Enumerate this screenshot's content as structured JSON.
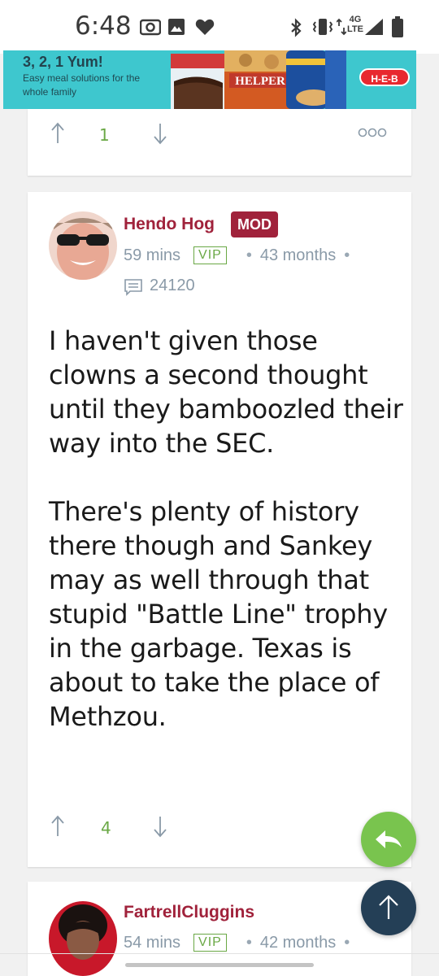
{
  "status_bar": {
    "time": "6:48",
    "network": "4G LTE",
    "icons": [
      "camera-icon",
      "gallery-icon",
      "heart-icon",
      "bluetooth-icon",
      "vibrate-icon",
      "signal-icon",
      "battery-icon"
    ]
  },
  "ad": {
    "title": "3, 2, 1 Yum!",
    "subtitle": "Easy meal solutions for the whole family",
    "product_name": "HELPER",
    "logo": "H-E-B",
    "background": "#3ec7ce"
  },
  "previous_post": {
    "votes": "1",
    "more_icon": "more-dots-icon"
  },
  "post": {
    "author": "Hendo Hog",
    "role_badge": "MOD",
    "time_ago": "59 mins",
    "tier": "VIP",
    "tenure": "43 months",
    "post_count": "24120",
    "paragraphs": [
      "I haven't given those clowns a second thought until they bamboozled their way into the SEC.",
      "There's plenty of history there though and Sankey may as well through that stupid \"Battle Line\" trophy in the garbage. Texas is about to take the place of Methzou."
    ],
    "votes": "4"
  },
  "next_post": {
    "author": "FartrellCluggins",
    "time_ago": "54 mins",
    "tier": "VIP",
    "tenure": "42 months"
  },
  "colors": {
    "author": "#a0223b",
    "vote_count": "#6aa845",
    "reply_button": "#79c44e",
    "scroll_top_button": "#243f56"
  }
}
